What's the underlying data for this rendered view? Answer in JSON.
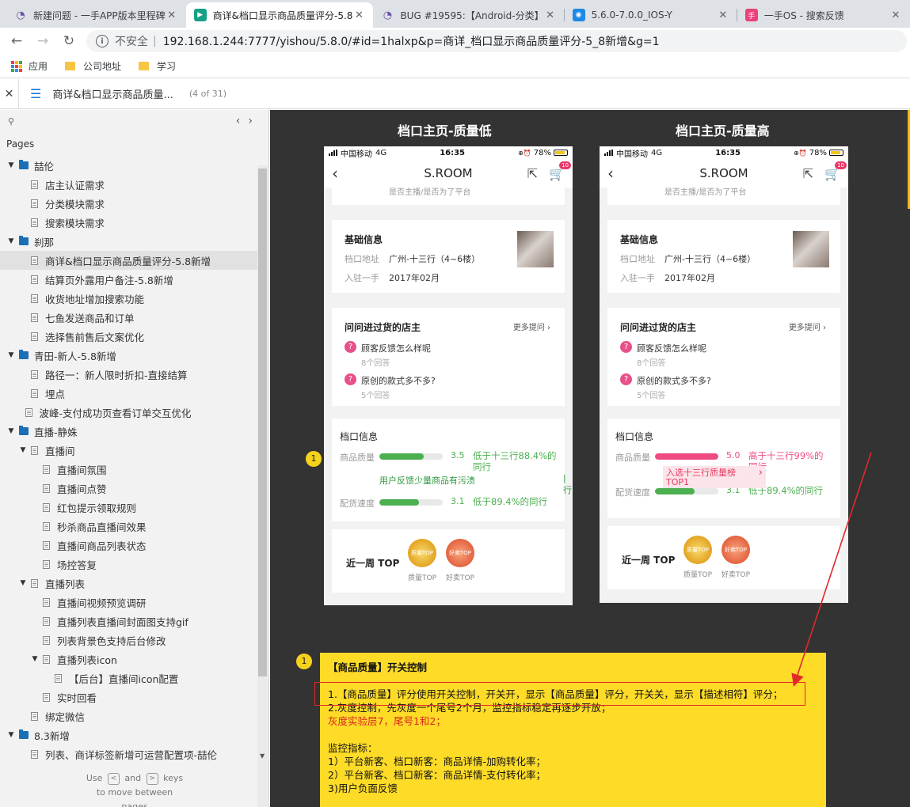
{
  "browser": {
    "tabs": [
      {
        "title": "新建问题 - 一手APP版本里程碑",
        "favicon": "odoo-icon",
        "active": false
      },
      {
        "title": "商详&档口显示商品质量评分-5.8",
        "favicon": "axure-icon",
        "active": true
      },
      {
        "title": "BUG #19595:【Android-分类】",
        "favicon": "odoo-icon",
        "active": false
      },
      {
        "title": "5.6.0-7.0.0_IOS-Y",
        "favicon": "app-icon",
        "active": false
      },
      {
        "title": "一手OS - 搜索反馈",
        "favicon": "yishou-icon",
        "active": false
      }
    ],
    "address": {
      "security": "不安全",
      "url": "192.168.1.244:7777/yishou/5.8.0/#id=1halxp&p=商详_档口显示商品质量评分-5_8新增&g=1"
    },
    "bookmarks": [
      "应用",
      "公司地址",
      "学习"
    ]
  },
  "axure": {
    "page_name": "商详&档口显示商品质量...",
    "page_count": "(4 of 31)",
    "pages_label": "Pages",
    "hint": {
      "use": "Use",
      "and": "and",
      "keys": "keys",
      "line2": "to move between",
      "line3": "pages",
      "left_key": "<",
      "right_key": ">"
    }
  },
  "tree": [
    {
      "label": "喆伦",
      "type": "folder",
      "depth": 0,
      "caret": "▼"
    },
    {
      "label": "店主认证需求",
      "type": "page",
      "depth": 1
    },
    {
      "label": "分类模块需求",
      "type": "page",
      "depth": 1
    },
    {
      "label": "搜索模块需求",
      "type": "page",
      "depth": 1
    },
    {
      "label": "刹那",
      "type": "folder",
      "depth": 0,
      "caret": "▼"
    },
    {
      "label": "商详&档口显示商品质量评分-5.8新增",
      "type": "page",
      "depth": 1,
      "selected": true
    },
    {
      "label": "结算页外露用户备注-5.8新增",
      "type": "page",
      "depth": 1
    },
    {
      "label": "收货地址增加搜索功能",
      "type": "page",
      "depth": 1
    },
    {
      "label": "七鱼发送商品和订单",
      "type": "page",
      "depth": 1
    },
    {
      "label": "选择售前售后文案优化",
      "type": "page",
      "depth": 1
    },
    {
      "label": "青田-新人-5.8新增",
      "type": "folder",
      "depth": 0,
      "caret": "▼"
    },
    {
      "label": "路径一：新人限时折扣-直接结算",
      "type": "page",
      "depth": 1
    },
    {
      "label": "埋点",
      "type": "page",
      "depth": 1
    },
    {
      "label": "波峰-支付成功页查看订单交互优化",
      "type": "page",
      "depth": 0.5
    },
    {
      "label": "直播-静姝",
      "type": "folder",
      "depth": 0,
      "caret": "▼"
    },
    {
      "label": "直播间",
      "type": "page",
      "depth": 1,
      "caret": "▼"
    },
    {
      "label": "直播间氛围",
      "type": "page",
      "depth": 2
    },
    {
      "label": "直播间点赞",
      "type": "page",
      "depth": 2
    },
    {
      "label": "红包提示领取规则",
      "type": "page",
      "depth": 2
    },
    {
      "label": "秒杀商品直播间效果",
      "type": "page",
      "depth": 2
    },
    {
      "label": "直播间商品列表状态",
      "type": "page",
      "depth": 2
    },
    {
      "label": "场控答复",
      "type": "page",
      "depth": 2
    },
    {
      "label": "直播列表",
      "type": "page",
      "depth": 1,
      "caret": "▼"
    },
    {
      "label": "直播间视频预览调研",
      "type": "page",
      "depth": 2
    },
    {
      "label": "直播列表直播间封面图支持gif",
      "type": "page",
      "depth": 2
    },
    {
      "label": "列表背景色支持后台修改",
      "type": "page",
      "depth": 2
    },
    {
      "label": "直播列表icon",
      "type": "page",
      "depth": 2,
      "caret": "▼"
    },
    {
      "label": "【后台】直播间icon配置",
      "type": "page",
      "depth": 3
    },
    {
      "label": "实时回看",
      "type": "page",
      "depth": 2
    },
    {
      "label": "绑定微信",
      "type": "page",
      "depth": 1
    },
    {
      "label": "8.3新增",
      "type": "folder",
      "depth": 0,
      "caret": "▼"
    },
    {
      "label": "列表、商详标签新增可运营配置项-喆伦",
      "type": "page",
      "depth": 1
    }
  ],
  "colors": {
    "green": "#4caf50",
    "pink": "#f04a85",
    "note_yellow": "#fddb27",
    "red": "#e02a2a"
  },
  "mockups": [
    {
      "heading": "档口主页-质量低",
      "status": {
        "carrier": "中国移动",
        "network": "4G",
        "time": "16:35",
        "battery": "78%"
      },
      "shop_name": "S.ROOM",
      "cart_count": "10",
      "top_snippet": "是否主播/是否为了平台",
      "basic": {
        "title": "基础信息",
        "addr_label": "档口地址",
        "addr_value": "广州-十三行（4~6楼）",
        "join_label": "入驻一手",
        "join_value": "2017年02月"
      },
      "qa": {
        "title": "问问进过货的店主",
        "more": "更多提问 ›",
        "items": [
          {
            "q": "顾客反馈怎么样呢",
            "n": "8个回答"
          },
          {
            "q": "原创的款式多不多?",
            "n": "5个回答"
          }
        ]
      },
      "stall": {
        "title": "档口信息",
        "metrics": [
          {
            "label": "商品质量",
            "score": "3.5",
            "level": 0.7,
            "compare": "低于十三行88.4%的同行",
            "color": "#4caf50"
          },
          {
            "label": "配货速度",
            "score": "3.1",
            "level": 0.62,
            "compare": "低于89.4%的同行",
            "color": "#4caf50"
          }
        ],
        "feedback_overlay": "用户反馈少量商品有污渍",
        "overlay_tail": "|行"
      },
      "top_week": {
        "title": "近一周 TOP",
        "m1": "质量TOP",
        "m2": "好卖TOP",
        "m1_in": "质量TOP",
        "m2_in": "好卖TOP"
      },
      "marker": "1"
    },
    {
      "heading": "档口主页-质量高",
      "status": {
        "carrier": "中国移动",
        "network": "4G",
        "time": "16:35",
        "battery": "78%"
      },
      "shop_name": "S.ROOM",
      "cart_count": "10",
      "top_snippet": "是否主播/是否为了平台",
      "basic": {
        "title": "基础信息",
        "addr_label": "档口地址",
        "addr_value": "广州-十三行（4~6楼）",
        "join_label": "入驻一手",
        "join_value": "2017年02月"
      },
      "qa": {
        "title": "问问进过货的店主",
        "more": "更多提问 ›",
        "items": [
          {
            "q": "顾客反馈怎么样呢",
            "n": "8个回答"
          },
          {
            "q": "原创的款式多不多?",
            "n": "5个回答"
          }
        ]
      },
      "stall": {
        "title": "档口信息",
        "metrics": [
          {
            "label": "商品质量",
            "score": "5.0",
            "level": 1.0,
            "compare": "高于十三行99%的同行",
            "color": "#f04a85"
          },
          {
            "label": "配货速度",
            "score": "3.1",
            "level": 0.62,
            "compare": "低于89.4%的同行",
            "color": "#4caf50"
          }
        ],
        "rank_tag": "入选十三行质量榜TOP1"
      },
      "top_week": {
        "title": "近一周 TOP",
        "m1": "质量TOP",
        "m2": "好卖TOP",
        "m1_in": "质量TOP",
        "m2_in": "好卖TOP"
      }
    }
  ],
  "note": {
    "marker": "1",
    "title": "【商品质量】开关控制",
    "lines": [
      {
        "text": "1.【商品质量】评分使用开关控制，开关开，显示【商品质量】评分，开关关，显示【描述相符】评分；",
        "style": "normal"
      },
      {
        "text": "2.灰度控制，先灰度一个尾号2个月，监控指标稳定再逐步开放；",
        "style": "normal"
      },
      {
        "text": "灰度实验层7，尾号1和2；",
        "style": "red"
      },
      {
        "text": "",
        "style": "blank"
      },
      {
        "text": "监控指标：",
        "style": "normal"
      },
      {
        "text": "1）平台新客、档口新客：商品详情-加购转化率；",
        "style": "normal"
      },
      {
        "text": "2）平台新客、档口新客：商品详情-支付转化率；",
        "style": "normal"
      },
      {
        "text": "3)用户负面反馈",
        "style": "normal"
      }
    ]
  }
}
